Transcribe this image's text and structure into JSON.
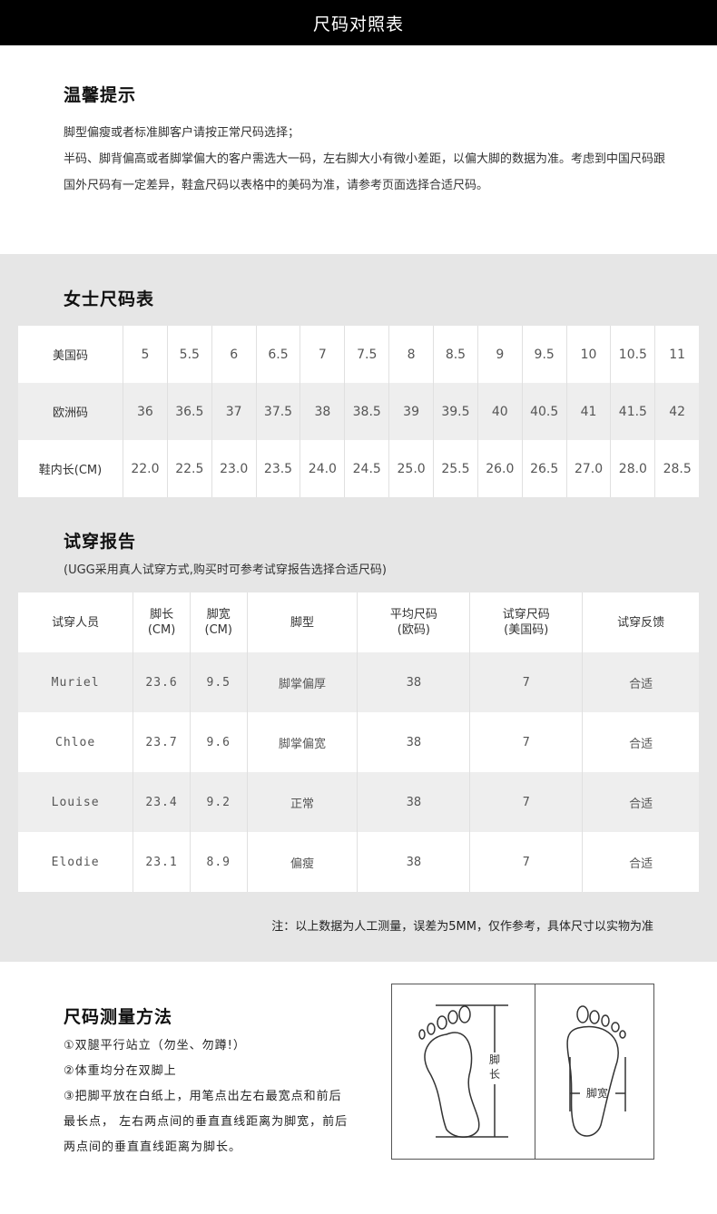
{
  "header": {
    "title": "尺码对照表"
  },
  "tips": {
    "title": "温馨提示",
    "lines": [
      "脚型偏瘦或者标准脚客户请按正常尺码选择；",
      "半码、脚背偏高或者脚掌偏大的客户需选大一码，左右脚大小有微小差距，以偏大脚的数据为准。考虑到中国尺码跟国外尺码有一定差异，鞋盒尺码以表格中的美码为准，请参考页面选择合适尺码。"
    ]
  },
  "women_size": {
    "title": "女士尺码表",
    "rows": [
      {
        "label": "美国码",
        "values": [
          "5",
          "5.5",
          "6",
          "6.5",
          "7",
          "7.5",
          "8",
          "8.5",
          "9",
          "9.5",
          "10",
          "10.5",
          "11"
        ]
      },
      {
        "label": "欧洲码",
        "values": [
          "36",
          "36.5",
          "37",
          "37.5",
          "38",
          "38.5",
          "39",
          "39.5",
          "40",
          "40.5",
          "41",
          "41.5",
          "42"
        ]
      },
      {
        "label": "鞋内长(CM)",
        "values": [
          "22.0",
          "22.5",
          "23.0",
          "23.5",
          "24.0",
          "24.5",
          "25.0",
          "25.5",
          "26.0",
          "26.5",
          "27.0",
          "28.0",
          "28.5"
        ]
      }
    ]
  },
  "trial": {
    "title": "试穿报告",
    "note": "(UGG采用真人试穿方式,购买时可参考试穿报告选择合适尺码)",
    "headers": [
      {
        "l1": "试穿人员",
        "l2": ""
      },
      {
        "l1": "脚长",
        "l2": "(CM)"
      },
      {
        "l1": "脚宽",
        "l2": "(CM)"
      },
      {
        "l1": "脚型",
        "l2": ""
      },
      {
        "l1": "平均尺码",
        "l2": "(欧码)"
      },
      {
        "l1": "试穿尺码",
        "l2": "(美国码)"
      },
      {
        "l1": "试穿反馈",
        "l2": ""
      }
    ],
    "rows": [
      [
        "Muriel",
        "23.6",
        "9.5",
        "脚掌偏厚",
        "38",
        "7",
        "合适"
      ],
      [
        "Chloe",
        "23.7",
        "9.6",
        "脚掌偏宽",
        "38",
        "7",
        "合适"
      ],
      [
        "Louise",
        "23.4",
        "9.2",
        "正常",
        "38",
        "7",
        "合适"
      ],
      [
        "Elodie",
        "23.1",
        "8.9",
        "偏瘦",
        "38",
        "7",
        "合适"
      ]
    ],
    "footnote": "注：以上数据为人工测量，误差为5MM，仅作参考，具体尺寸以实物为准"
  },
  "measure": {
    "title": "尺码测量方法",
    "steps": [
      "①双腿平行站立（勿坐、勿蹲!）",
      "②体重均分在双脚上",
      "③把脚平放在白纸上，用笔点出左右最宽点和前后最长点， 左右两点间的垂直直线距离为脚宽，前后两点间的垂直直线距离为脚长。"
    ],
    "diagram": {
      "length_label": "脚长",
      "width_label": "脚宽"
    }
  }
}
